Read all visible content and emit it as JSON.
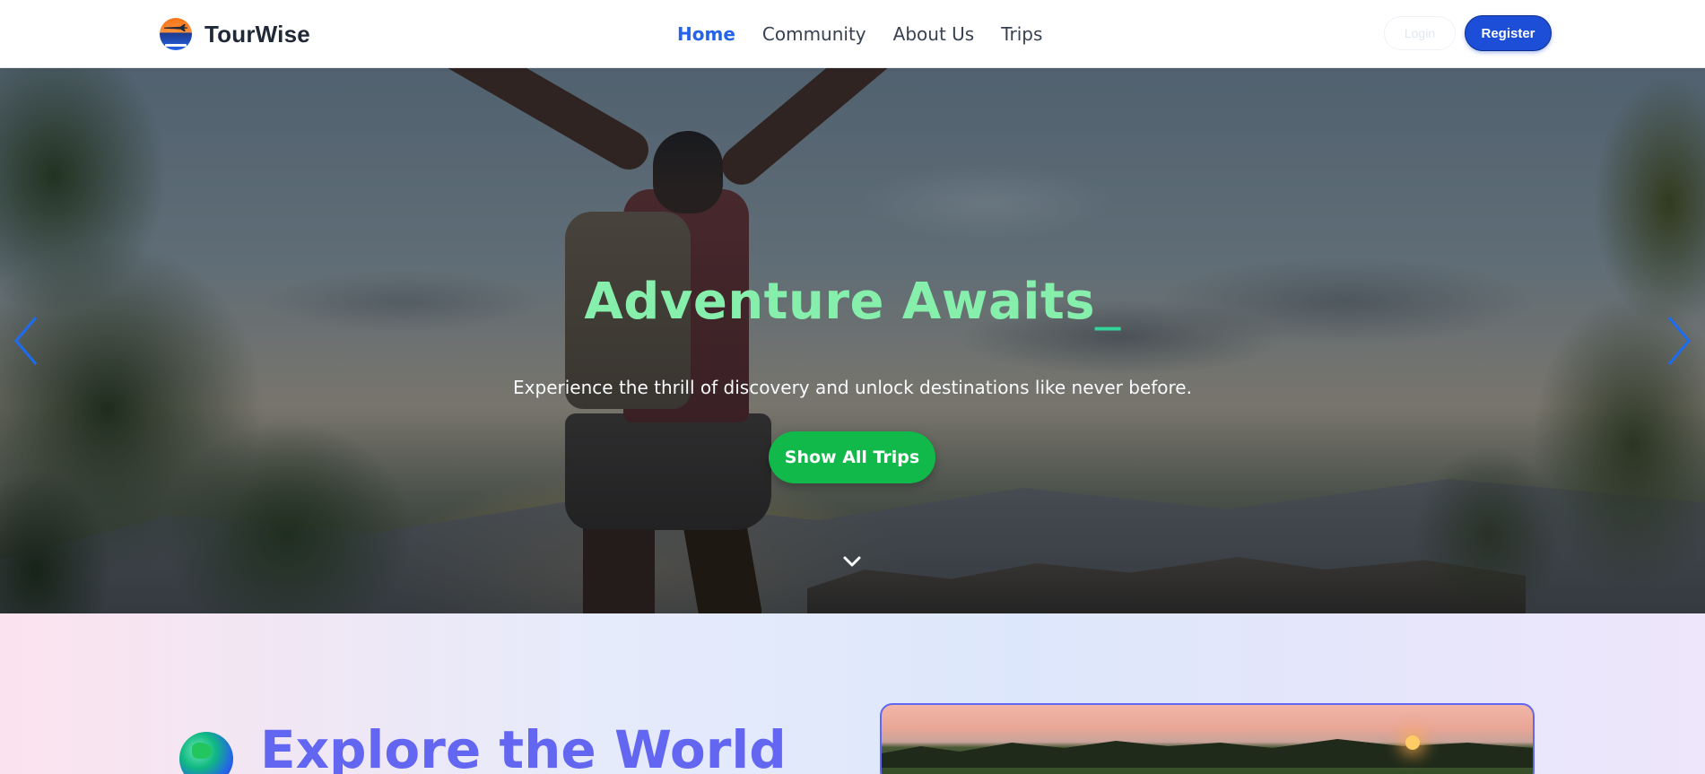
{
  "nav": {
    "brand": "TourWise",
    "links": [
      {
        "label": "Home",
        "active": true
      },
      {
        "label": "Community",
        "active": false
      },
      {
        "label": "About Us",
        "active": false
      },
      {
        "label": "Trips",
        "active": false
      }
    ],
    "login_label": "Login",
    "register_label": "Register"
  },
  "hero": {
    "title": "Adventure Awaits",
    "cursor": "_",
    "subtitle": "Experience the thrill of discovery and unlock destinations like never before.",
    "cta_label": "Show All Trips"
  },
  "explore": {
    "title": "Explore the World",
    "icon": "globe-emoji"
  },
  "colors": {
    "accent": "#2563eb",
    "register_bg": "#1d4ed8",
    "cta_bg": "#10b94a",
    "hero_title": "#86efac",
    "explore_title": "#6366f1",
    "carousel_arrow": "#1d6cf0"
  }
}
